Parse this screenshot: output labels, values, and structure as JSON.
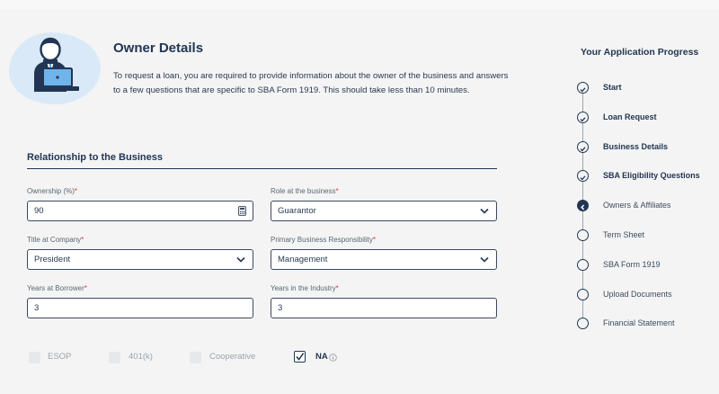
{
  "owner": {
    "title": "Owner Details",
    "intro": "To request a loan, you are required to provide information about the owner of the business and answers to a few questions that are specific to SBA Form 1919. This should take less than 10 minutes."
  },
  "relationship": {
    "title": "Relationship to the Business",
    "ownership": {
      "label": "Ownership (%)",
      "value": "90"
    },
    "role": {
      "label": "Role at the business",
      "value": "Guarantor"
    },
    "title_at_company": {
      "label": "Title at Company",
      "value": "President"
    },
    "primary_responsibility": {
      "label": "Primary Business Responsibility",
      "value": "Management"
    },
    "years_at_borrower": {
      "label": "Years at Borrower",
      "value": "3"
    },
    "years_in_industry": {
      "label": "Years in the Industry",
      "value": "3"
    },
    "required_marker": "*"
  },
  "plans": [
    {
      "label": "ESOP",
      "checked": false
    },
    {
      "label": "401(k)",
      "checked": false
    },
    {
      "label": "Cooperative",
      "checked": false
    },
    {
      "label": "NA",
      "checked": true
    }
  ],
  "progress": {
    "title": "Your Application Progress",
    "steps": [
      {
        "label": "Start",
        "status": "done"
      },
      {
        "label": "Loan Request",
        "status": "done"
      },
      {
        "label": "Business Details",
        "status": "done"
      },
      {
        "label": "SBA Eligibility Questions",
        "status": "done"
      },
      {
        "label": "Owners & Affiliates",
        "status": "current"
      },
      {
        "label": "Term Sheet",
        "status": "pending"
      },
      {
        "label": "SBA Form 1919",
        "status": "pending"
      },
      {
        "label": "Upload Documents",
        "status": "pending"
      },
      {
        "label": "Financial Statement",
        "status": "pending"
      }
    ]
  },
  "colors": {
    "navy": "#223653",
    "required": "#d9342b",
    "avatar_bg": "#d9e9f7"
  },
  "icons": {
    "avatar": "businessman-at-laptop-icon",
    "select": "chevron-down-icon",
    "stepper": "calculator-icon",
    "check": "checkmark-icon",
    "info": "info-icon"
  }
}
